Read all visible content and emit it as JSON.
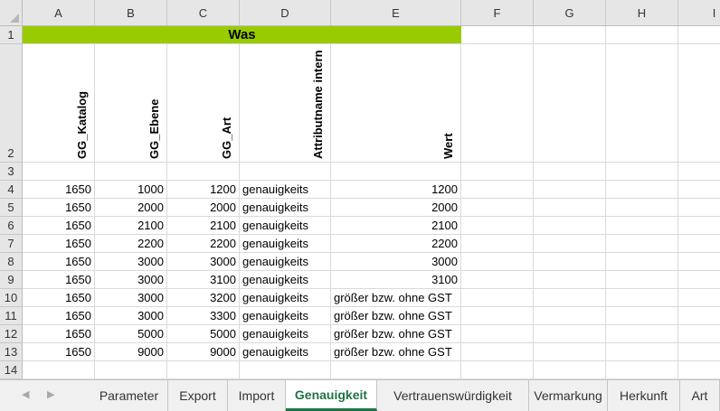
{
  "columns": [
    "A",
    "B",
    "C",
    "D",
    "E",
    "F",
    "G",
    "H",
    "I"
  ],
  "rows": [
    "1",
    "2",
    "3",
    "4",
    "5",
    "6",
    "7",
    "8",
    "9",
    "10",
    "11",
    "12",
    "13",
    "14"
  ],
  "title": "Was",
  "headers": [
    "GG_Katalog",
    "GG_Ebene",
    "GG_Art",
    "Attributname intern",
    "Wert"
  ],
  "data": [
    [
      "1650",
      "1000",
      "1200",
      "genauigkeits",
      "1200"
    ],
    [
      "1650",
      "2000",
      "2000",
      "genauigkeits",
      "2000"
    ],
    [
      "1650",
      "2100",
      "2100",
      "genauigkeits",
      "2100"
    ],
    [
      "1650",
      "2200",
      "2200",
      "genauigkeits",
      "2200"
    ],
    [
      "1650",
      "3000",
      "3000",
      "genauigkeits",
      "3000"
    ],
    [
      "1650",
      "3000",
      "3100",
      "genauigkeits",
      "3100"
    ],
    [
      "1650",
      "3000",
      "3200",
      "genauigkeits",
      "größer bzw. ohne GST"
    ],
    [
      "1650",
      "3000",
      "3300",
      "genauigkeits",
      "größer bzw. ohne GST"
    ],
    [
      "1650",
      "5000",
      "5000",
      "genauigkeits",
      "größer bzw. ohne GST"
    ],
    [
      "1650",
      "9000",
      "9000",
      "genauigkeits",
      "größer bzw. ohne GST"
    ]
  ],
  "sheets": [
    "Parameter",
    "Export",
    "Import",
    "Genauigkeit",
    "Vertrauenswürdigkeit",
    "Vermarkung",
    "Herkunft",
    "Art"
  ],
  "active_sheet": "Genauigkeit",
  "colors": {
    "title_fill": "#99cc00",
    "active_tab": "#217346"
  }
}
